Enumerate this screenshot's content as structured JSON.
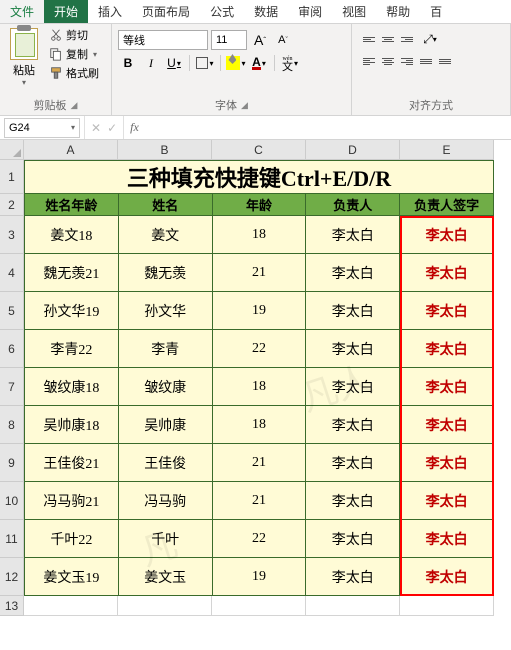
{
  "tabs": [
    "文件",
    "开始",
    "插入",
    "页面布局",
    "公式",
    "数据",
    "审阅",
    "视图",
    "帮助",
    "百"
  ],
  "active_tab_index": 1,
  "ribbon": {
    "clipboard": {
      "label": "剪贴板",
      "paste": "粘贴",
      "cut": "剪切",
      "copy": "复制",
      "format_painter": "格式刷"
    },
    "font": {
      "label": "字体",
      "name": "等线",
      "size": "11",
      "grow": "A",
      "shrink": "A",
      "ruby": "wén"
    },
    "alignment": {
      "label": "对齐方式"
    }
  },
  "namebox": "G24",
  "columns": [
    "A",
    "B",
    "C",
    "D",
    "E"
  ],
  "row_headers": [
    "1",
    "2",
    "3",
    "4",
    "5",
    "6",
    "7",
    "8",
    "9",
    "10",
    "11",
    "12",
    "13"
  ],
  "table": {
    "title": "三种填充快捷键Ctrl+E/D/R",
    "headers": [
      "姓名年龄",
      "姓名",
      "年龄",
      "负责人",
      "负责人签字"
    ],
    "rows": [
      [
        "姜文18",
        "姜文",
        "18",
        "李太白",
        "李太白"
      ],
      [
        "魏无羡21",
        "魏无羡",
        "21",
        "李太白",
        "李太白"
      ],
      [
        "孙文华19",
        "孙文华",
        "19",
        "李太白",
        "李太白"
      ],
      [
        "李青22",
        "李青",
        "22",
        "李太白",
        "李太白"
      ],
      [
        "皱纹康18",
        "皱纹康",
        "18",
        "李太白",
        "李太白"
      ],
      [
        "吴帅康18",
        "吴帅康",
        "18",
        "李太白",
        "李太白"
      ],
      [
        "王佳俊21",
        "王佳俊",
        "21",
        "李太白",
        "李太白"
      ],
      [
        "冯马驹21",
        "冯马驹",
        "21",
        "李太白",
        "李太白"
      ],
      [
        "千叶22",
        "千叶",
        "22",
        "李太白",
        "李太白"
      ],
      [
        "姜文玉19",
        "姜文玉",
        "19",
        "李太白",
        "李太白"
      ]
    ]
  }
}
